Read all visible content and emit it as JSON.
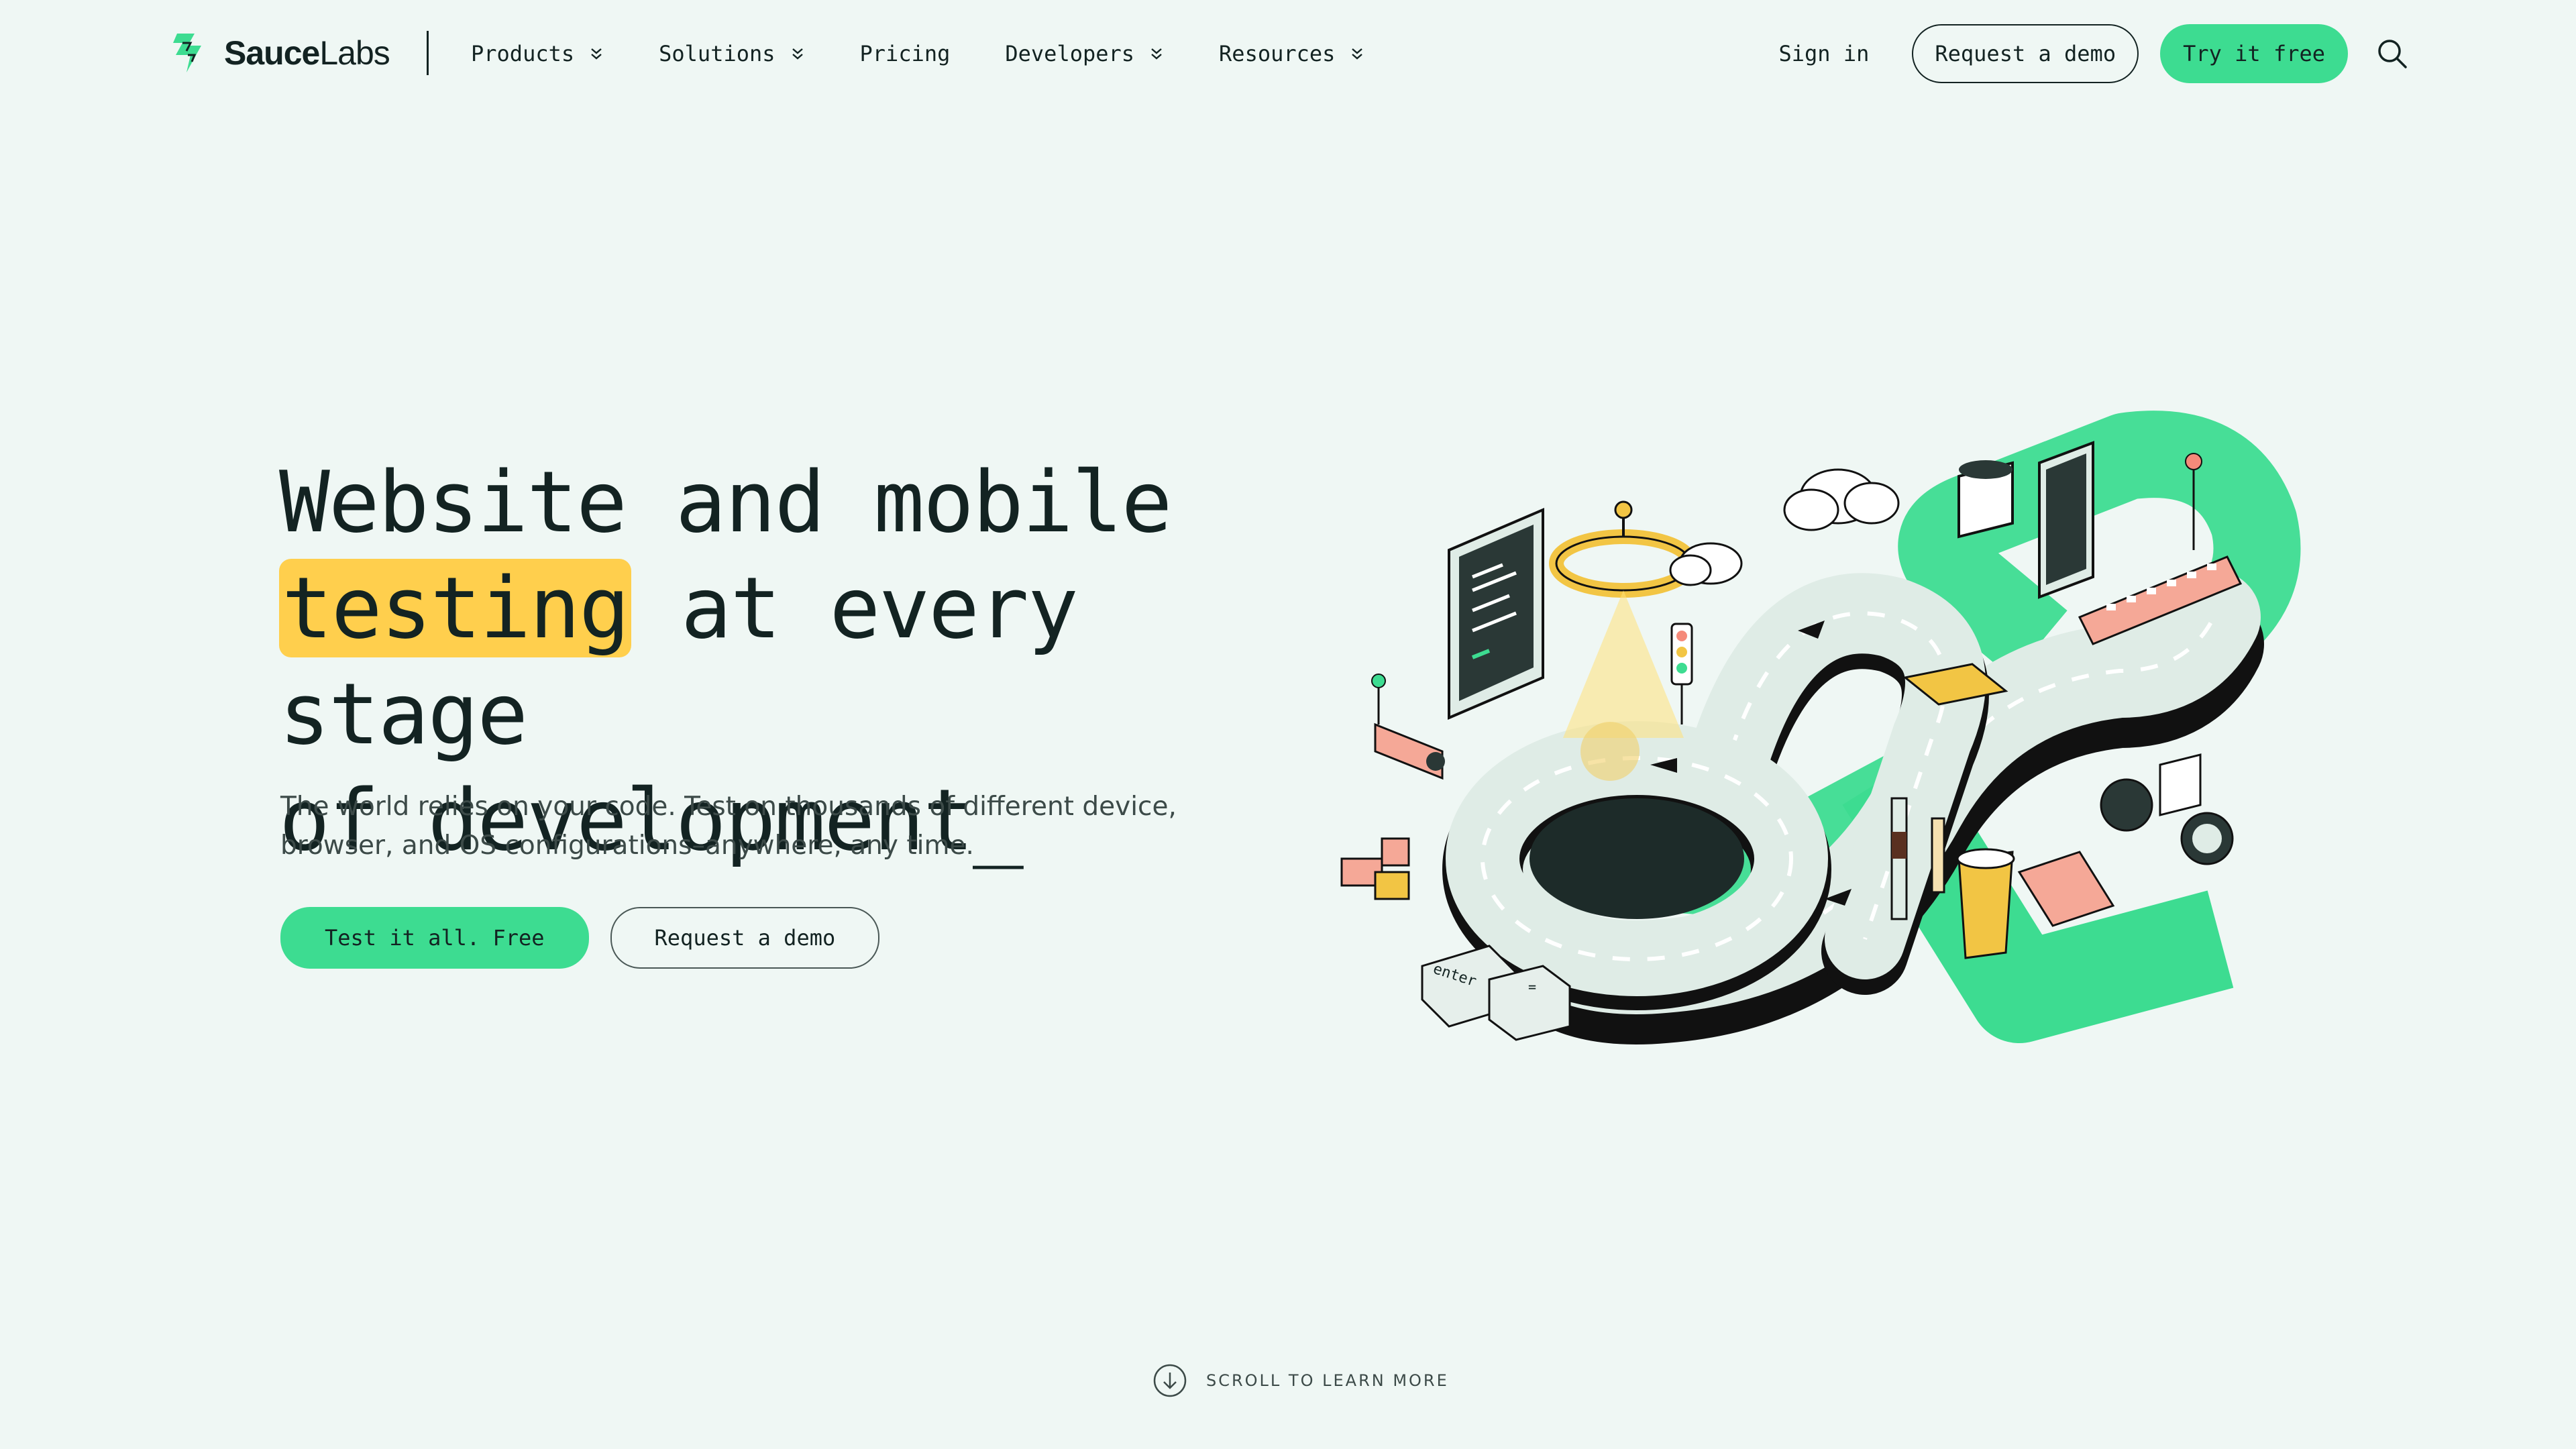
{
  "brand": {
    "name_bold": "Sauce",
    "name_light": "Labs",
    "accent": "#3ddc91",
    "highlight": "#ffcf4d",
    "background": "#eff7f4"
  },
  "nav": {
    "items": [
      {
        "label": "Products",
        "has_dropdown": true
      },
      {
        "label": "Solutions",
        "has_dropdown": true
      },
      {
        "label": "Pricing",
        "has_dropdown": false
      },
      {
        "label": "Developers",
        "has_dropdown": true
      },
      {
        "label": "Resources",
        "has_dropdown": true
      }
    ],
    "sign_in": "Sign in",
    "request_demo": "Request a demo",
    "try_free": "Try it free",
    "search_icon": "search-icon"
  },
  "hero": {
    "title_line1": "Website and mobile",
    "title_highlight": "testing",
    "title_line2_rest": " at every stage",
    "title_line3": "of development_",
    "subtitle_line1": "The world relies on your code. Test on thousands of different device,",
    "subtitle_line2": "browser, and OS configurations–anywhere, any time.",
    "cta_primary": "Test it all. Free",
    "cta_secondary": "Request a demo"
  },
  "illustration": {
    "key_enter": "enter",
    "key_equals": "="
  },
  "scroll": {
    "label": "SCROLL TO LEARN MORE"
  }
}
